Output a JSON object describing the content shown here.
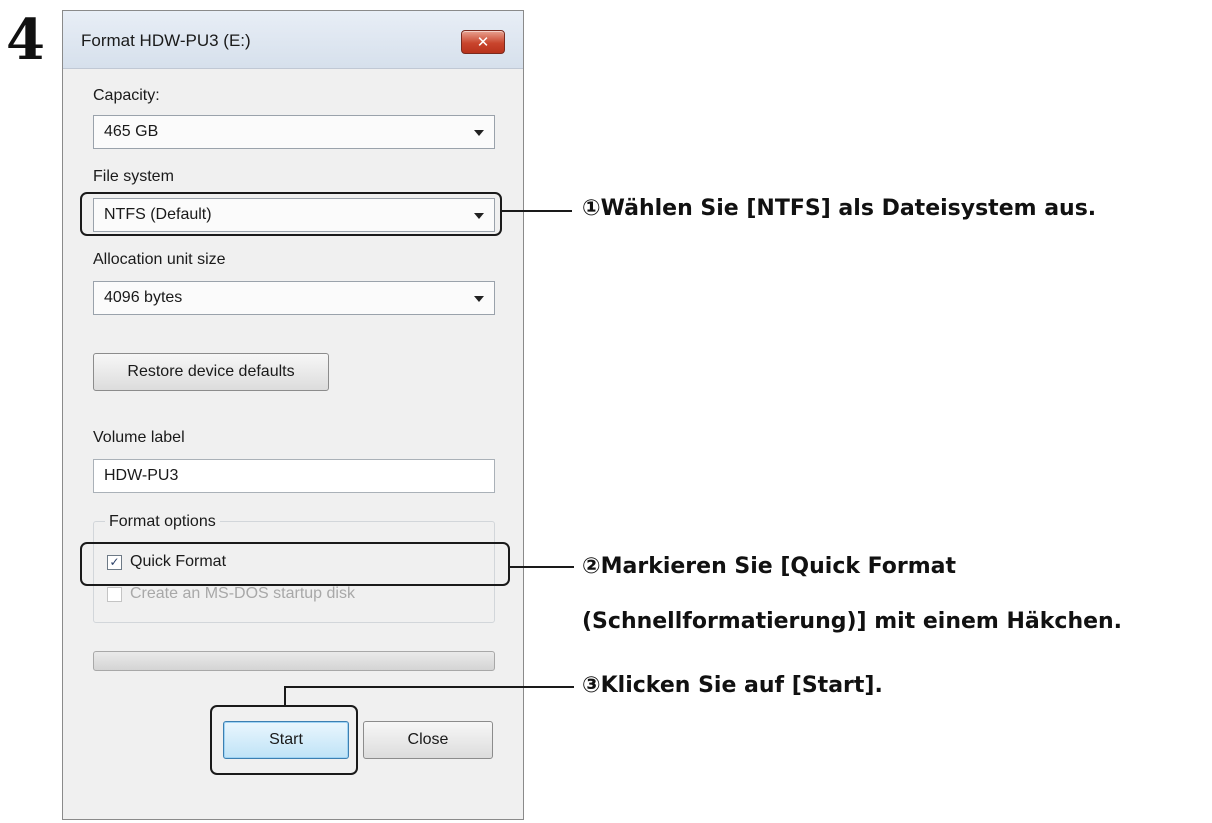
{
  "step": {
    "number": "4"
  },
  "dialog": {
    "title": "Format HDW-PU3 (E:)",
    "close_glyph": "✕",
    "capacity": {
      "label": "Capacity:",
      "value": "465 GB"
    },
    "file_system": {
      "label": "File system",
      "value": "NTFS (Default)"
    },
    "allocation": {
      "label": "Allocation unit size",
      "value": "4096 bytes"
    },
    "restore_label": "Restore device defaults",
    "volume": {
      "label": "Volume label",
      "value": "HDW-PU3"
    },
    "format_options": {
      "title": "Format options",
      "quick_format": {
        "label": "Quick Format",
        "checked": true,
        "glyph": "✓"
      },
      "msdos": {
        "label": "Create an MS-DOS startup disk",
        "checked": false,
        "enabled": false
      }
    },
    "progress": {
      "value": 0
    },
    "buttons": {
      "start": "Start",
      "close": "Close"
    }
  },
  "annotations": {
    "callout1": "①Wählen Sie [NTFS] als Dateisystem aus.",
    "callout2_line1": "②Markieren Sie [Quick Format",
    "callout2_line2": "(Schnellformatierung)] mit einem Häkchen.",
    "callout3": "③Klicken Sie auf [Start]."
  },
  "icons": {
    "close": "close-icon",
    "dropdown": "chevron-down-icon",
    "checkbox": "checkmark-icon"
  },
  "colors": {
    "close_button": "#c9452d",
    "primary_button_border": "#3c7fb1",
    "dialog_background": "#f0f0f0"
  }
}
